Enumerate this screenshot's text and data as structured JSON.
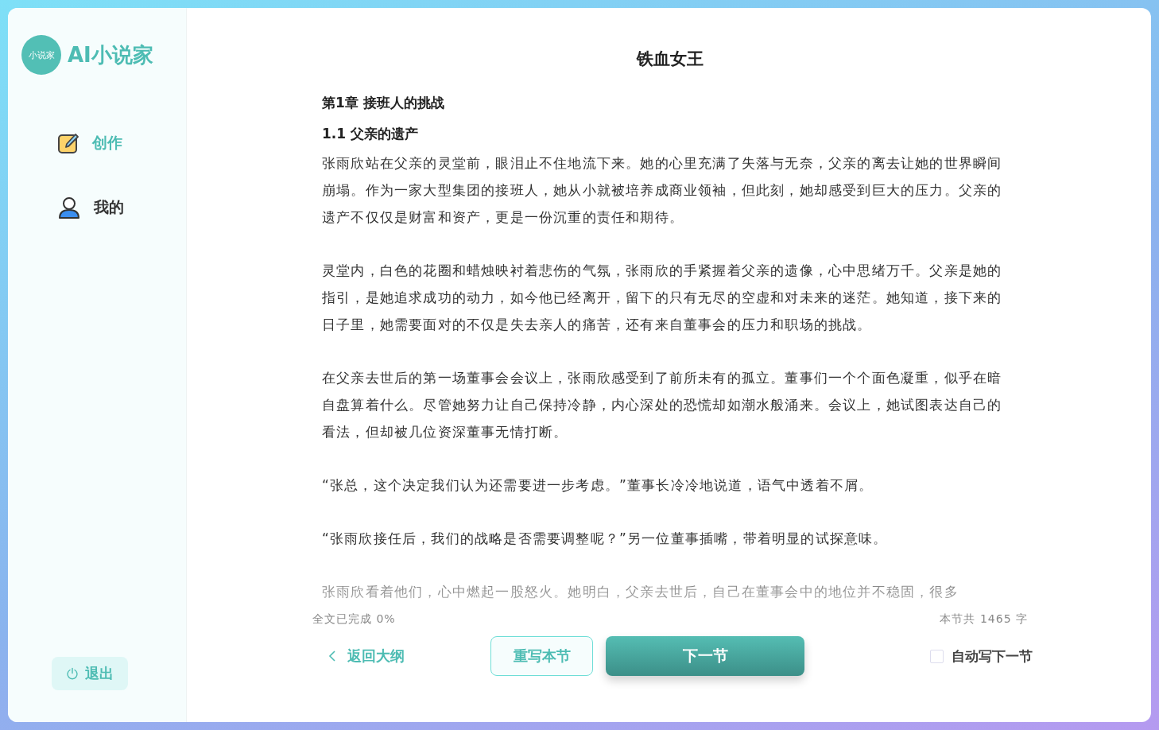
{
  "sidebar": {
    "logo_badge": "小说家",
    "logo_text": "AI小说家",
    "items": [
      {
        "label": "创作",
        "kind": "write",
        "selected": true
      },
      {
        "label": "我的",
        "kind": "profile",
        "selected": false
      }
    ],
    "logout": "退出"
  },
  "document": {
    "title": "铁血女王",
    "chapter": "第1章 接班人的挑战",
    "section": "1.1 父亲的遗产",
    "paragraphs": [
      "张雨欣站在父亲的灵堂前，眼泪止不住地流下来。她的心里充满了失落与无奈，父亲的离去让她的世界瞬间崩塌。作为一家大型集团的接班人，她从小就被培养成商业领袖，但此刻，她却感受到巨大的压力。父亲的遗产不仅仅是财富和资产，更是一份沉重的责任和期待。",
      "灵堂内，白色的花圈和蜡烛映衬着悲伤的气氛，张雨欣的手紧握着父亲的遗像，心中思绪万千。父亲是她的指引，是她追求成功的动力，如今他已经离开，留下的只有无尽的空虚和对未来的迷茫。她知道，接下来的日子里，她需要面对的不仅是失去亲人的痛苦，还有来自董事会的压力和职场的挑战。",
      "在父亲去世后的第一场董事会会议上，张雨欣感受到了前所未有的孤立。董事们一个个面色凝重，似乎在暗自盘算着什么。尽管她努力让自己保持冷静，内心深处的恐慌却如潮水般涌来。会议上，她试图表达自己的看法，但却被几位资深董事无情打断。",
      "“张总，这个决定我们认为还需要进一步考虑。”董事长冷冷地说道，语气中透着不屑。",
      "“张雨欣接任后，我们的战略是否需要调整呢？”另一位董事插嘴，带着明显的试探意味。",
      "张雨欣看着他们，心中燃起一股怒火。她明白，父亲去世后，自己在董事会中的地位并不稳固，很多"
    ]
  },
  "footer": {
    "progress": "全文已完成 0%",
    "word_count": "本节共 1465 字",
    "back_link": "返回大纲",
    "rewrite_button": "重写本节",
    "next_button": "下一节",
    "auto_next": {
      "label": "自动写下一节",
      "checked": false
    }
  }
}
